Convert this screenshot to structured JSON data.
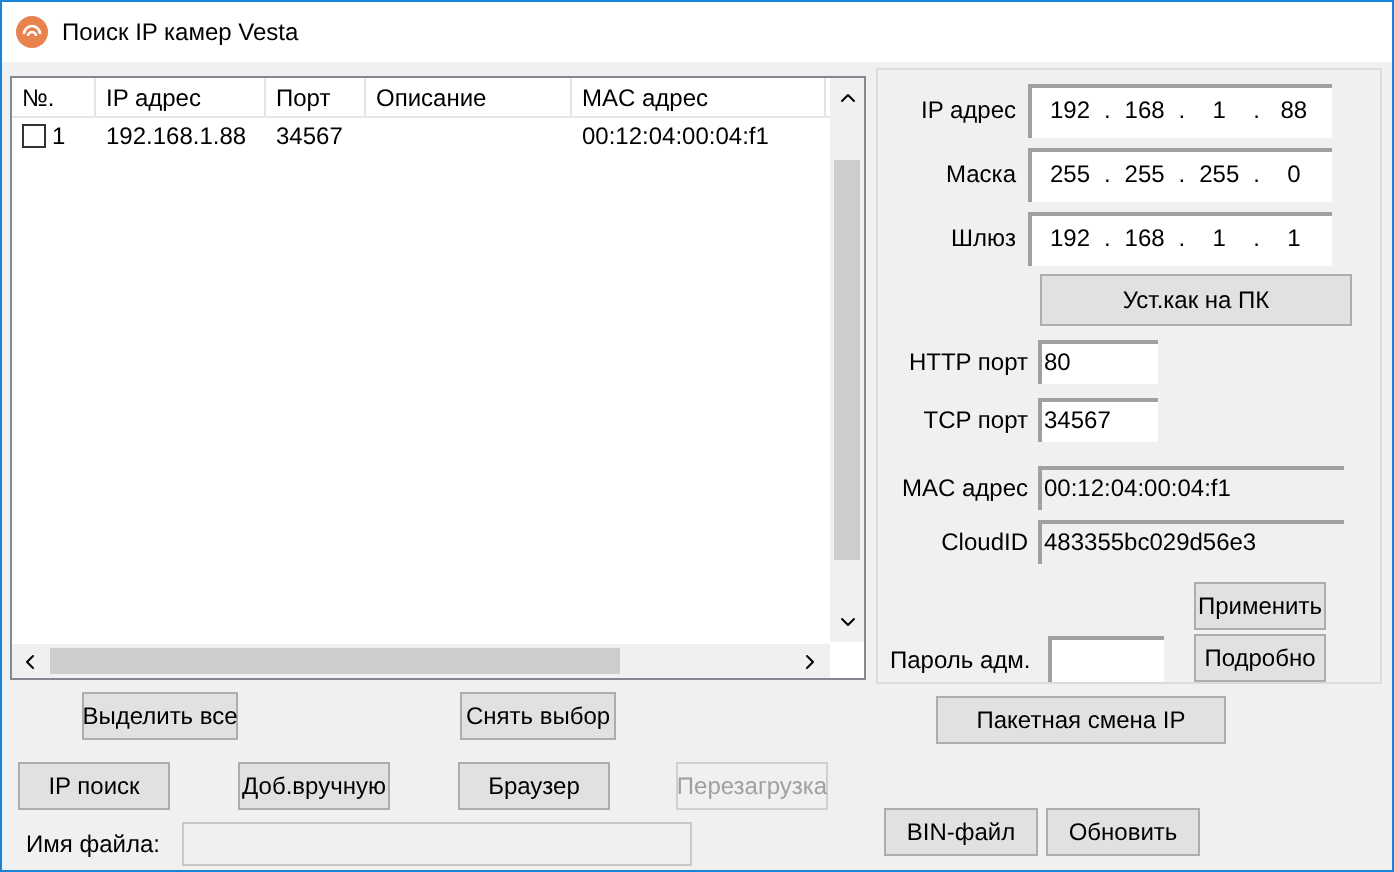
{
  "window": {
    "title": "Поиск IP камер Vesta"
  },
  "table": {
    "columns": [
      "№.",
      "IP адрес",
      "Порт",
      "Описание",
      "MAC адрес"
    ],
    "rows": [
      {
        "checked": false,
        "cells": [
          "1",
          "192.168.1.88",
          "34567",
          "",
          "00:12:04:00:04:f1"
        ]
      }
    ]
  },
  "select_buttons": [
    "Выделить все",
    "Снять выбор"
  ],
  "action_buttons": [
    {
      "label": "IP поиск",
      "disabled": false
    },
    {
      "label": "Доб.вручную",
      "disabled": false
    },
    {
      "label": "Браузер",
      "disabled": false
    },
    {
      "label": "Перезагрузка",
      "disabled": true
    }
  ],
  "file": {
    "label": "Имя файла:"
  },
  "settings": {
    "ip_fields": [
      {
        "label": "IP адрес",
        "separator": ".",
        "octets": [
          "192",
          "168",
          "1",
          "88"
        ]
      },
      {
        "label": "Маска",
        "separator": ".",
        "octets": [
          "255",
          "255",
          "255",
          "0"
        ]
      },
      {
        "label": "Шлюз",
        "separator": ".",
        "octets": [
          "192",
          "168",
          "1",
          "1"
        ]
      }
    ],
    "set_pc_button": "Уст.как на ПК",
    "ports": [
      {
        "label": "HTTP порт",
        "value": "80"
      },
      {
        "label": "TCP порт",
        "value": "34567"
      }
    ],
    "readonly": [
      {
        "label": "MAC адрес",
        "value": "00:12:04:00:04:f1"
      },
      {
        "label": "CloudID",
        "value": "483355bc029d56e3"
      }
    ],
    "apply_button": "Применить",
    "details_button": "Подробно",
    "password_label": "Пароль адм."
  },
  "batch_button": "Пакетная смена IP",
  "bottom_buttons": [
    "BIN-файл",
    "Обновить"
  ]
}
